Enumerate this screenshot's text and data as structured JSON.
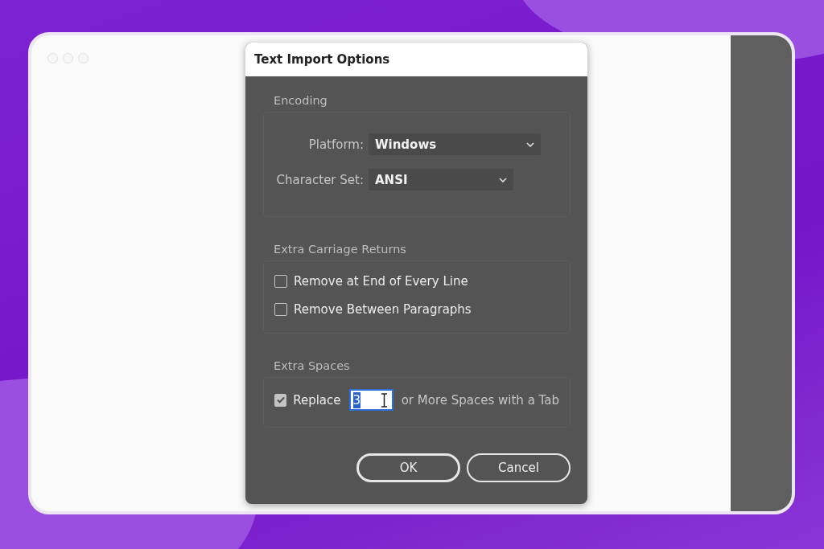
{
  "window": {
    "title": "Text Import Options"
  },
  "encoding": {
    "title": "Encoding",
    "fields": [
      {
        "label": "Platform:",
        "value": "Windows",
        "wide": true
      },
      {
        "label": "Character Set:",
        "value": "ANSI",
        "wide": false
      }
    ]
  },
  "carriage_returns": {
    "title": "Extra Carriage Returns",
    "options": [
      {
        "label": "Remove at End of Every Line",
        "checked": false
      },
      {
        "label": "Remove Between Paragraphs",
        "checked": false
      }
    ]
  },
  "extra_spaces": {
    "title": "Extra Spaces",
    "checked": true,
    "label": "Replace",
    "value": "3",
    "suffix": "or More Spaces with a Tab"
  },
  "buttons": [
    {
      "label": "OK",
      "kind": "default"
    },
    {
      "label": "Cancel",
      "kind": "normal"
    }
  ]
}
